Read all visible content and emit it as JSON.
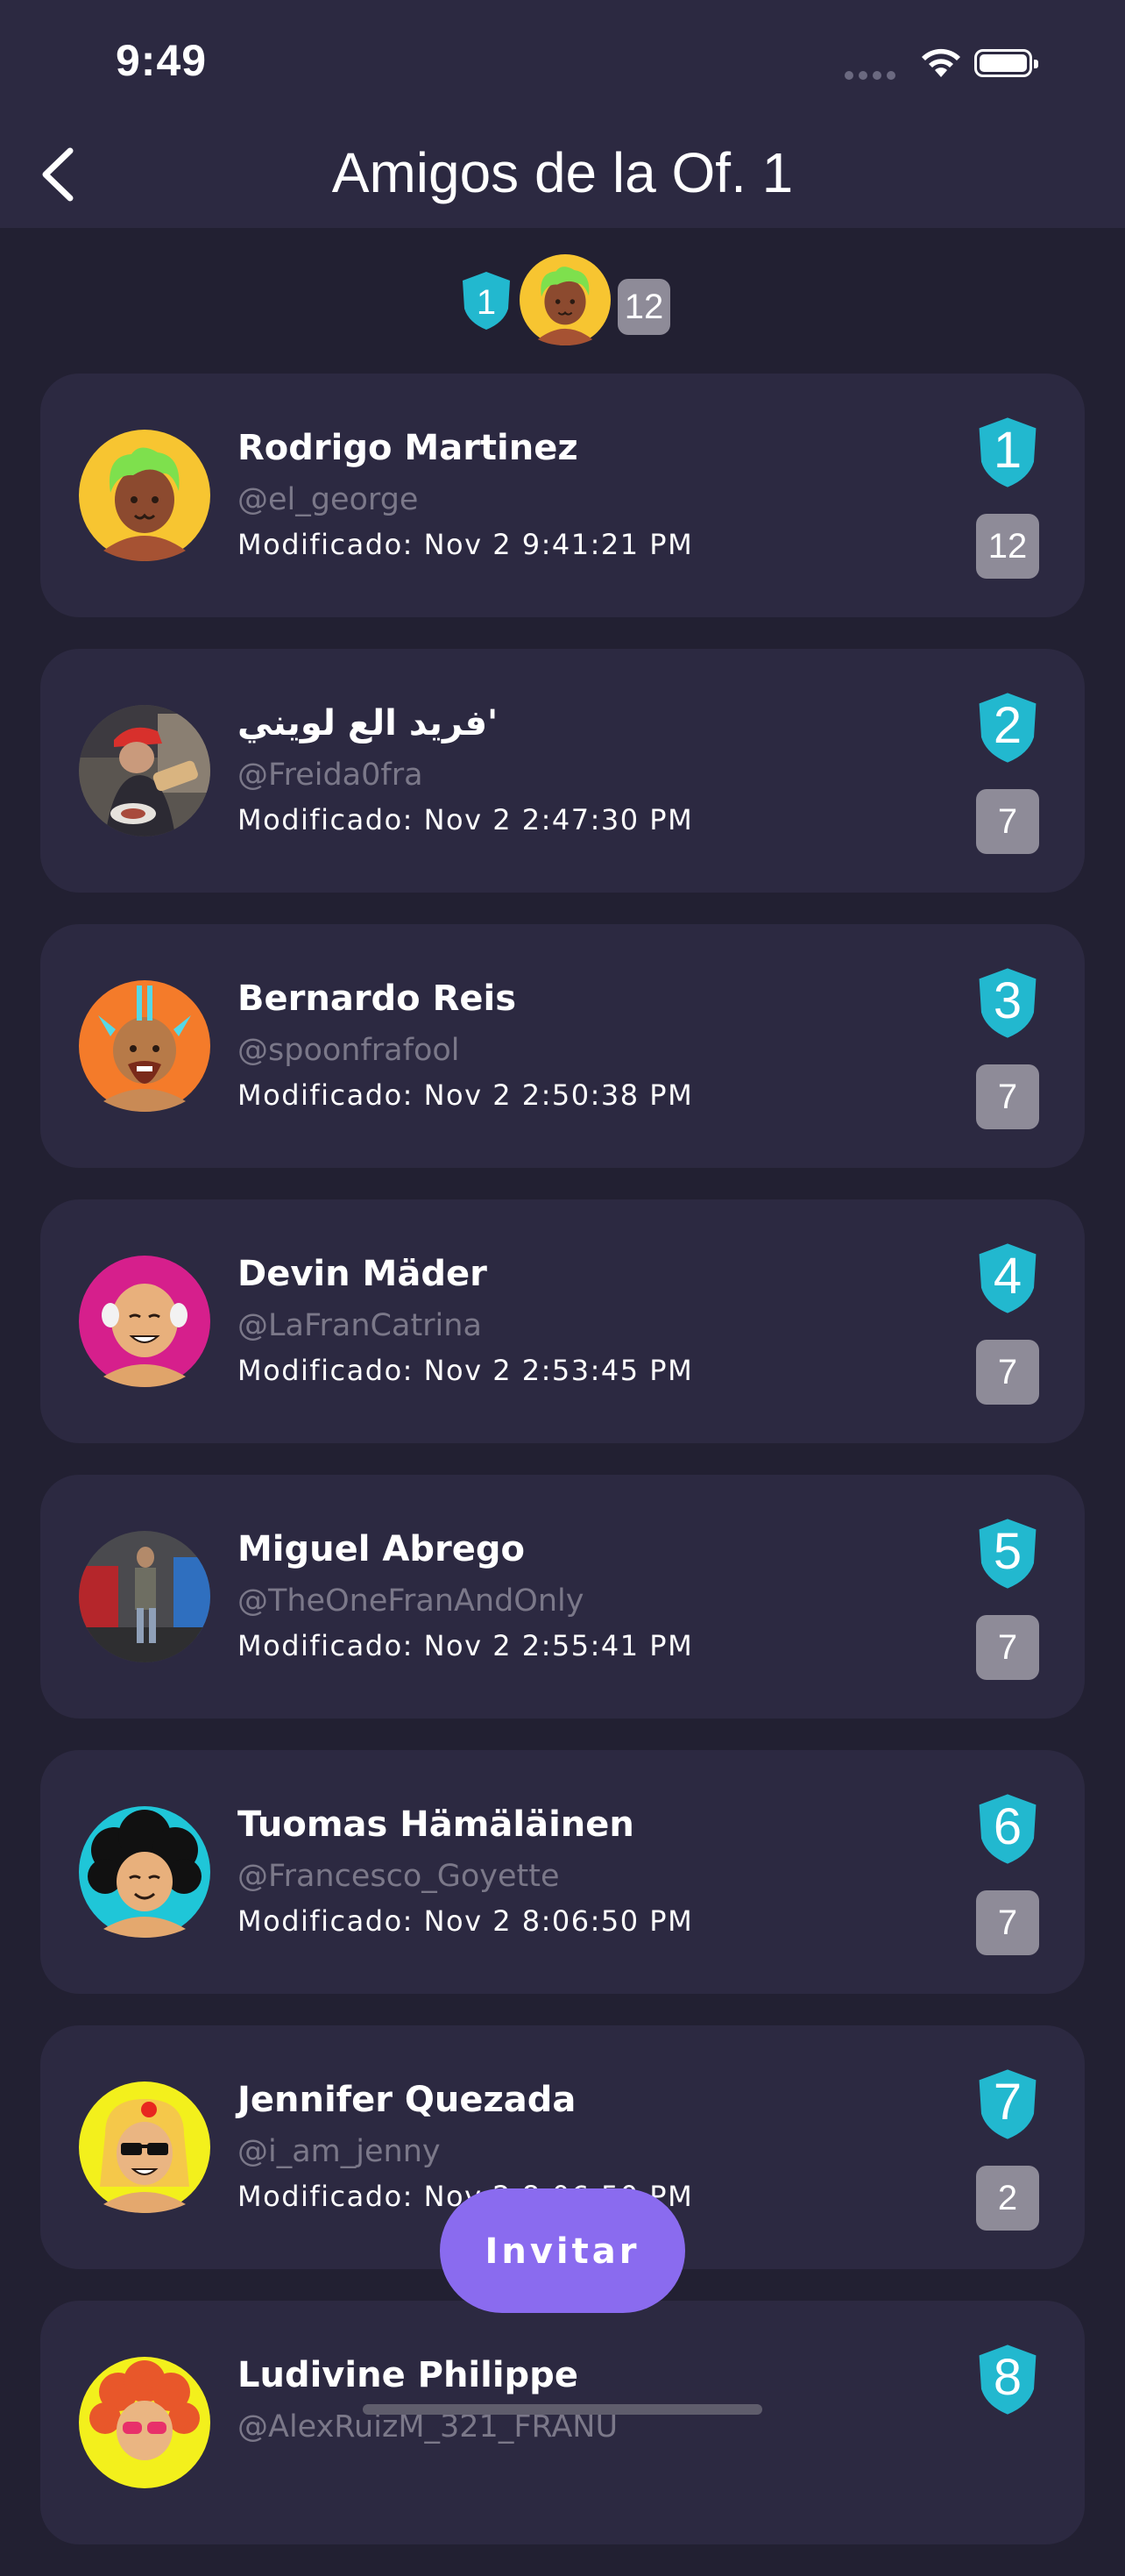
{
  "status": {
    "time": "9:49"
  },
  "nav": {
    "title": "Amigos de la Of. 1"
  },
  "summary": {
    "rank": "1",
    "count": "12"
  },
  "friends": [
    {
      "name": "Rodrigo Martinez",
      "handle": "@el_george",
      "modified": "Modificado: Nov 2 9:41:21 PM",
      "rank": "1",
      "count": "12",
      "avatar": "green-hair-avatar"
    },
    {
      "name": "فريد الع لويني'",
      "handle": "@Freida0fra",
      "modified": "Modificado: Nov 2 2:47:30 PM",
      "rank": "2",
      "count": "7",
      "avatar": "photo-avatar-red-cap"
    },
    {
      "name": "Bernardo Reis",
      "handle": "@spoonfrafool",
      "modified": "Modificado: Nov 2 2:50:38 PM",
      "rank": "3",
      "count": "7",
      "avatar": "orange-mohawk-avatar"
    },
    {
      "name": "Devin Mäder",
      "handle": "@LaFranCatrina",
      "modified": "Modificado: Nov 2 2:53:45 PM",
      "rank": "4",
      "count": "7",
      "avatar": "bald-avatar-magenta"
    },
    {
      "name": "Miguel Abrego",
      "handle": "@TheOneFranAndOnly",
      "modified": "Modificado: Nov 2 2:55:41 PM",
      "rank": "5",
      "count": "7",
      "avatar": "photo-avatar-street"
    },
    {
      "name": "Tuomas Hämäläinen",
      "handle": "@Francesco_Goyette",
      "modified": "Modificado: Nov 2 8:06:50 PM",
      "rank": "6",
      "count": "7",
      "avatar": "afro-avatar-cyan"
    },
    {
      "name": "Jennifer Quezada",
      "handle": "@i_am_jenny",
      "modified": "Modificado: Nov 2 8:06:50 PM",
      "rank": "7",
      "count": "2",
      "avatar": "sunglasses-avatar-yellow"
    },
    {
      "name": "Ludivine Philippe",
      "handle": "@AlexRuizM_321_FRANU",
      "modified": "",
      "rank": "8",
      "count": "",
      "avatar": "curly-red-avatar"
    }
  ],
  "actions": {
    "invite_label": "Invitar"
  },
  "colors": {
    "background": "#222032",
    "card": "#2c2941",
    "shield": "#22b8cf",
    "badge": "#8e8b98",
    "invite": "#8a6bef"
  }
}
